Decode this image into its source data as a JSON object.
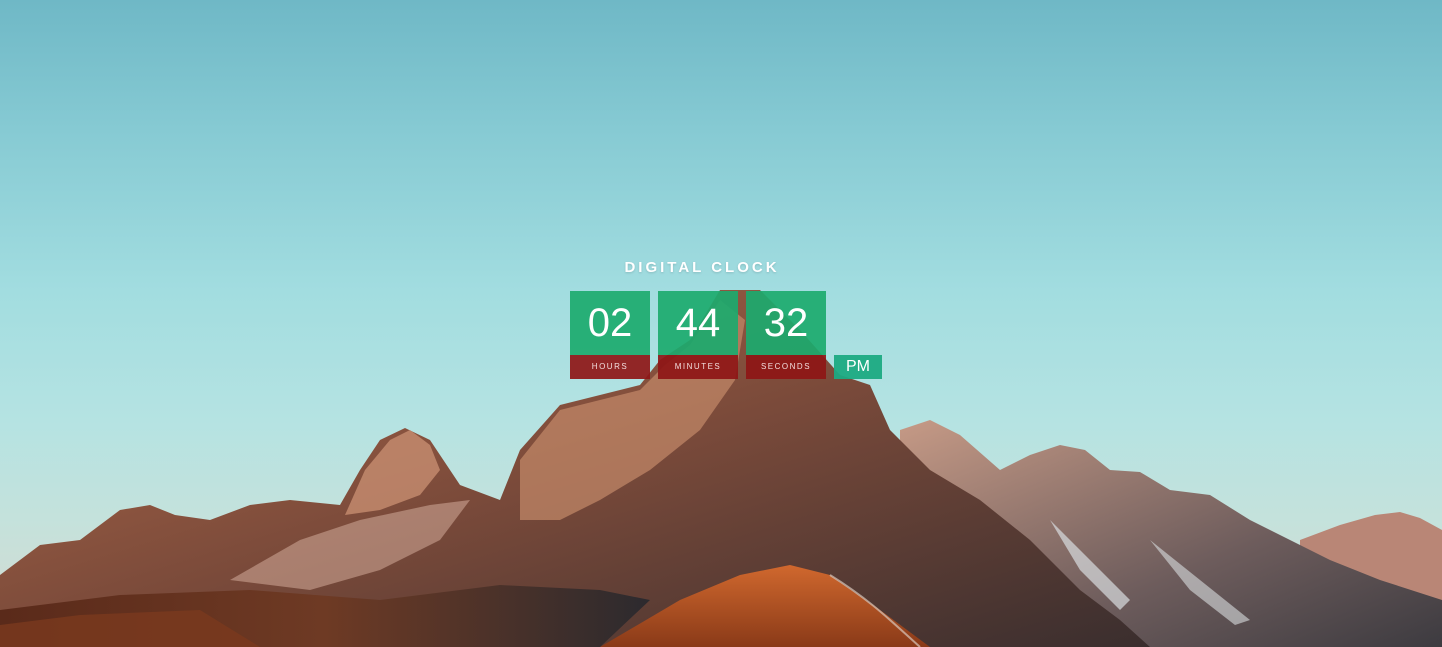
{
  "clock": {
    "title": "DIGITAL CLOCK",
    "hours": "02",
    "minutes": "44",
    "seconds": "32",
    "hours_label": "HOURS",
    "minutes_label": "MINUTES",
    "seconds_label": "SECONDS",
    "period": "PM"
  },
  "colors": {
    "digit_box": "#1caa6e",
    "label_box": "#8e1616",
    "period_box": "#1caa82"
  }
}
